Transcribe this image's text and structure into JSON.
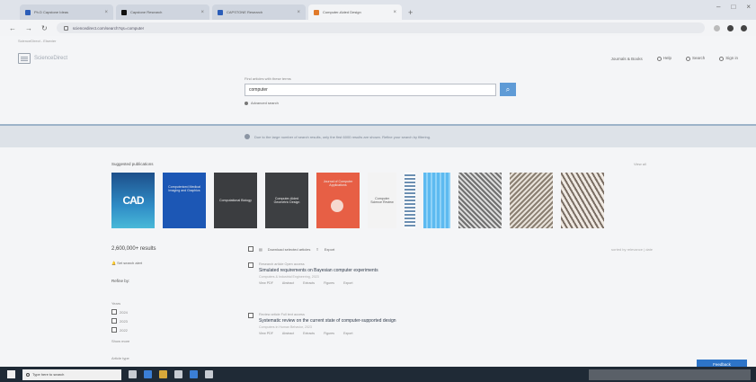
{
  "browser": {
    "tabs": [
      {
        "label": "Ph.D Capstone Ideas",
        "icon": "blue",
        "active": false
      },
      {
        "label": "Capstone Research",
        "icon": "dark",
        "active": false
      },
      {
        "label": "CAPSTONE Research",
        "icon": "blue",
        "active": false
      },
      {
        "label": "Computer-Aided Design",
        "icon": "orange",
        "active": true
      }
    ],
    "new_tab": "+",
    "url": "sciencedirect.com/search?qs=computer"
  },
  "site": {
    "top_strip": "ScienceDirect - Elsevier",
    "logo_text": "ScienceDirect",
    "header_links": [
      "Journals & Books",
      "Help",
      "Search",
      "Sign in"
    ]
  },
  "search": {
    "label": "Find articles with these terms",
    "value": "computer",
    "advanced_label": "Advanced search"
  },
  "notice": {
    "text": "Due to the large number of search results, only the first 6000 results are shown. Refine your search by filtering."
  },
  "publications": {
    "title": "Suggested publications",
    "view_all": "View all",
    "covers": [
      {
        "text": "CAD",
        "style": "cv-cad"
      },
      {
        "text": "Computerized Medical Imaging and Graphics",
        "style": "cv-blue"
      },
      {
        "text": "Computational Biology",
        "style": "cv-dark1"
      },
      {
        "text": "Computer-Aided Geometric Design",
        "style": "cv-dark2"
      },
      {
        "text": "Journal of Computer Applications",
        "style": "cv-orange"
      },
      {
        "text": "Computer Science Review",
        "style": "cv-white"
      },
      {
        "text": "",
        "style": "cv-strip"
      },
      {
        "text": "",
        "style": "cv-sky"
      },
      {
        "text": "",
        "style": "cv-noise1"
      },
      {
        "text": "",
        "style": "cv-noise2"
      },
      {
        "text": "",
        "style": "cv-noise3"
      }
    ]
  },
  "results": {
    "count": "2,600,000+ results",
    "set_alert": "Set search alert",
    "refine_by": "Refine by:",
    "years_label": "Years",
    "years": [
      "2024",
      "2023",
      "2022"
    ],
    "show_more": "Show more",
    "article_type": "Article type",
    "toolbar_download": "Download selected articles",
    "toolbar_export": "Export",
    "sort_label": "sorted by relevance | date",
    "items": [
      {
        "meta": "Research article  Open access",
        "title": "Simulated requirements on Bayesian computer experiments",
        "sub": "Computers & Industrial Engineering, 2023",
        "actions": [
          "View PDF",
          "Abstract",
          "Extracts",
          "Figures",
          "Export"
        ]
      },
      {
        "meta": "Review article  Full text access",
        "title": "Systematic review on the current state of computer-supported design",
        "sub": "Computers in Human Behavior, 2023",
        "actions": [
          "View PDF",
          "Abstract",
          "Extracts",
          "Figures",
          "Export"
        ]
      }
    ]
  },
  "feedback": "Feedback",
  "taskbar": {
    "search_placeholder": "Type here to search"
  }
}
